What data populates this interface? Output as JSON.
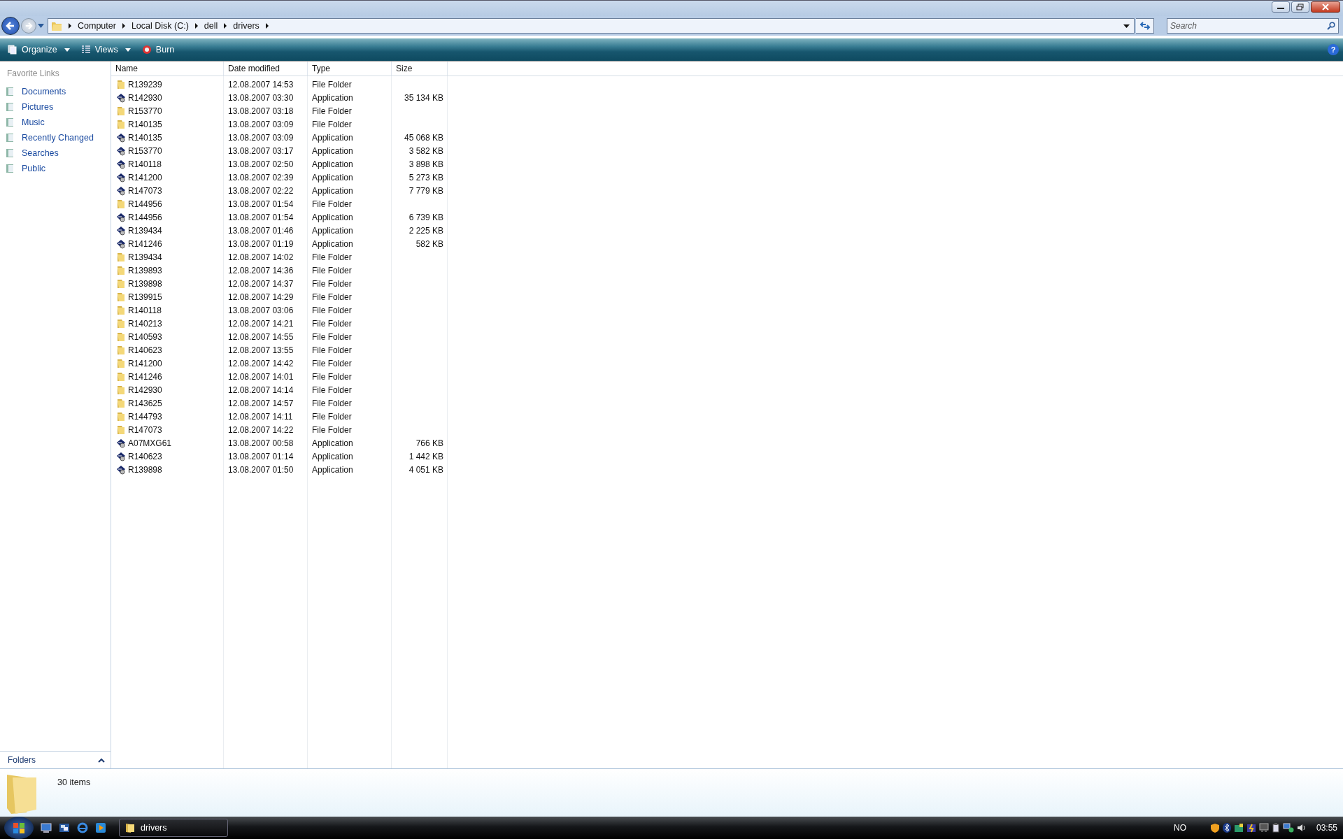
{
  "address_bar": {
    "breadcrumbs": [
      "Computer",
      "Local Disk (C:)",
      "dell",
      "drivers"
    ]
  },
  "search": {
    "placeholder": "Search"
  },
  "toolbar": {
    "buttons": [
      {
        "label": "Organize",
        "kind": "organize",
        "dropdown": true
      },
      {
        "label": "Views",
        "kind": "views",
        "dropdown": true
      },
      {
        "label": "Burn",
        "kind": "burn",
        "dropdown": false
      }
    ],
    "help": "?"
  },
  "sidebar": {
    "heading": "Favorite Links",
    "items": [
      {
        "label": "Documents"
      },
      {
        "label": "Pictures"
      },
      {
        "label": "Music"
      },
      {
        "label": "Recently Changed"
      },
      {
        "label": "Searches"
      },
      {
        "label": "Public"
      }
    ],
    "folders_label": "Folders"
  },
  "table": {
    "columns": [
      "Name",
      "Date modified",
      "Type",
      "Size"
    ],
    "rows": [
      {
        "name": "R139239",
        "date": "12.08.2007 14:53",
        "type": "File Folder",
        "kind": "folder"
      },
      {
        "name": "R142930",
        "date": "13.08.2007 03:30",
        "type": "Application",
        "size": "35 134 KB",
        "kind": "application"
      },
      {
        "name": "R153770",
        "date": "13.08.2007 03:18",
        "type": "File Folder",
        "kind": "folder"
      },
      {
        "name": "R140135",
        "date": "13.08.2007 03:09",
        "type": "File Folder",
        "kind": "folder"
      },
      {
        "name": "R140135",
        "date": "13.08.2007 03:09",
        "type": "Application",
        "size": "45 068 KB",
        "kind": "application"
      },
      {
        "name": "R153770",
        "date": "13.08.2007 03:17",
        "type": "Application",
        "size": "3 582 KB",
        "kind": "application"
      },
      {
        "name": "R140118",
        "date": "13.08.2007 02:50",
        "type": "Application",
        "size": "3 898 KB",
        "kind": "application"
      },
      {
        "name": "R141200",
        "date": "13.08.2007 02:39",
        "type": "Application",
        "size": "5 273 KB",
        "kind": "application"
      },
      {
        "name": "R147073",
        "date": "13.08.2007 02:22",
        "type": "Application",
        "size": "7 779 KB",
        "kind": "application"
      },
      {
        "name": "R144956",
        "date": "13.08.2007 01:54",
        "type": "File Folder",
        "kind": "folder"
      },
      {
        "name": "R144956",
        "date": "13.08.2007 01:54",
        "type": "Application",
        "size": "6 739 KB",
        "kind": "application"
      },
      {
        "name": "R139434",
        "date": "13.08.2007 01:46",
        "type": "Application",
        "size": "2 225 KB",
        "kind": "application"
      },
      {
        "name": "R141246",
        "date": "13.08.2007 01:19",
        "type": "Application",
        "size": "582 KB",
        "kind": "application"
      },
      {
        "name": "R139434",
        "date": "12.08.2007 14:02",
        "type": "File Folder",
        "kind": "folder"
      },
      {
        "name": "R139893",
        "date": "12.08.2007 14:36",
        "type": "File Folder",
        "kind": "folder"
      },
      {
        "name": "R139898",
        "date": "12.08.2007 14:37",
        "type": "File Folder",
        "kind": "folder"
      },
      {
        "name": "R139915",
        "date": "12.08.2007 14:29",
        "type": "File Folder",
        "kind": "folder"
      },
      {
        "name": "R140118",
        "date": "13.08.2007 03:06",
        "type": "File Folder",
        "kind": "folder"
      },
      {
        "name": "R140213",
        "date": "12.08.2007 14:21",
        "type": "File Folder",
        "kind": "folder"
      },
      {
        "name": "R140593",
        "date": "12.08.2007 14:55",
        "type": "File Folder",
        "kind": "folder"
      },
      {
        "name": "R140623",
        "date": "12.08.2007 13:55",
        "type": "File Folder",
        "kind": "folder"
      },
      {
        "name": "R141200",
        "date": "12.08.2007 14:42",
        "type": "File Folder",
        "kind": "folder"
      },
      {
        "name": "R141246",
        "date": "12.08.2007 14:01",
        "type": "File Folder",
        "kind": "folder"
      },
      {
        "name": "R142930",
        "date": "12.08.2007 14:14",
        "type": "File Folder",
        "kind": "folder"
      },
      {
        "name": "R143625",
        "date": "12.08.2007 14:57",
        "type": "File Folder",
        "kind": "folder"
      },
      {
        "name": "R144793",
        "date": "12.08.2007 14:11",
        "type": "File Folder",
        "kind": "folder"
      },
      {
        "name": "R147073",
        "date": "12.08.2007 14:22",
        "type": "File Folder",
        "kind": "folder"
      },
      {
        "name": "A07MXG61",
        "date": "13.08.2007 00:58",
        "type": "Application",
        "size": "766 KB",
        "kind": "application"
      },
      {
        "name": "R140623",
        "date": "13.08.2007 01:14",
        "type": "Application",
        "size": "1 442 KB",
        "kind": "application"
      },
      {
        "name": "R139898",
        "date": "13.08.2007 01:50",
        "type": "Application",
        "size": "4 051 KB",
        "kind": "application"
      }
    ]
  },
  "details_pane": {
    "item_count": "30 items"
  },
  "taskbar": {
    "window_button": "drivers",
    "language": "NO",
    "clock": "03:55"
  }
}
